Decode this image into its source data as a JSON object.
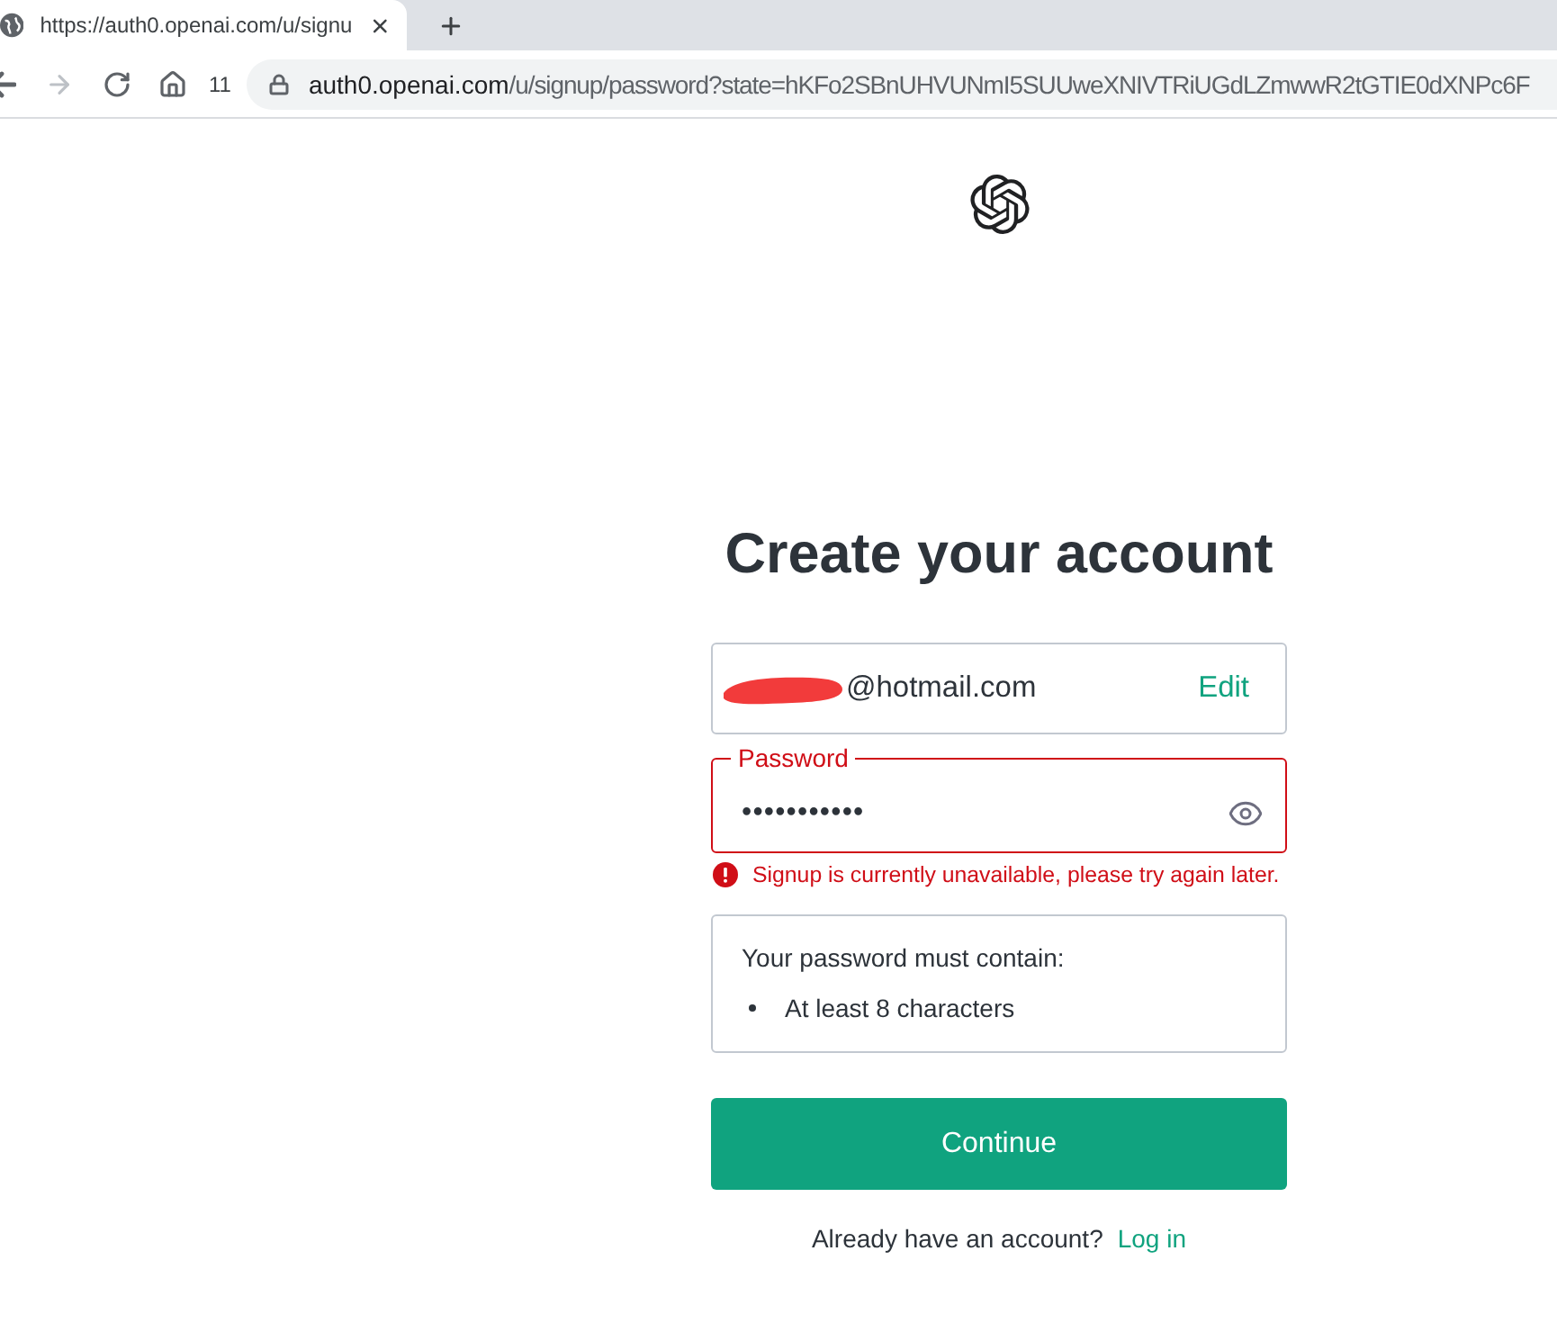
{
  "browser": {
    "tabs": [
      {
        "title": "https://auth0.openai.com/u/signu",
        "selected": true
      }
    ],
    "nav_buttons": [
      {
        "kind": "back",
        "disabled": false
      },
      {
        "kind": "forward",
        "disabled": true
      },
      {
        "kind": "reload",
        "disabled": false
      },
      {
        "kind": "home",
        "disabled": false
      }
    ],
    "toolbar_number": "11",
    "address": {
      "host": "auth0.openai.com",
      "path": "/u/signup/password?state=hKFo2SBnUHVUNmI5SUUweXNIVTRiUGdLZmwwR2tGTIE0dXNPc6F"
    }
  },
  "page": {
    "title": "Create your account",
    "email": {
      "value": "@hotmail.com",
      "redacted": true,
      "action": "Edit"
    },
    "password": {
      "label": "Password",
      "value": "•••••••••••",
      "invalid": true
    },
    "error": "Signup is currently unavailable, please try again later.",
    "requirements": {
      "heading": "Your password must contain:",
      "items": [
        "At least 8 characters"
      ]
    },
    "submit": "Continue",
    "login_prompt": "Already have an account?",
    "login_link": "Log in"
  }
}
